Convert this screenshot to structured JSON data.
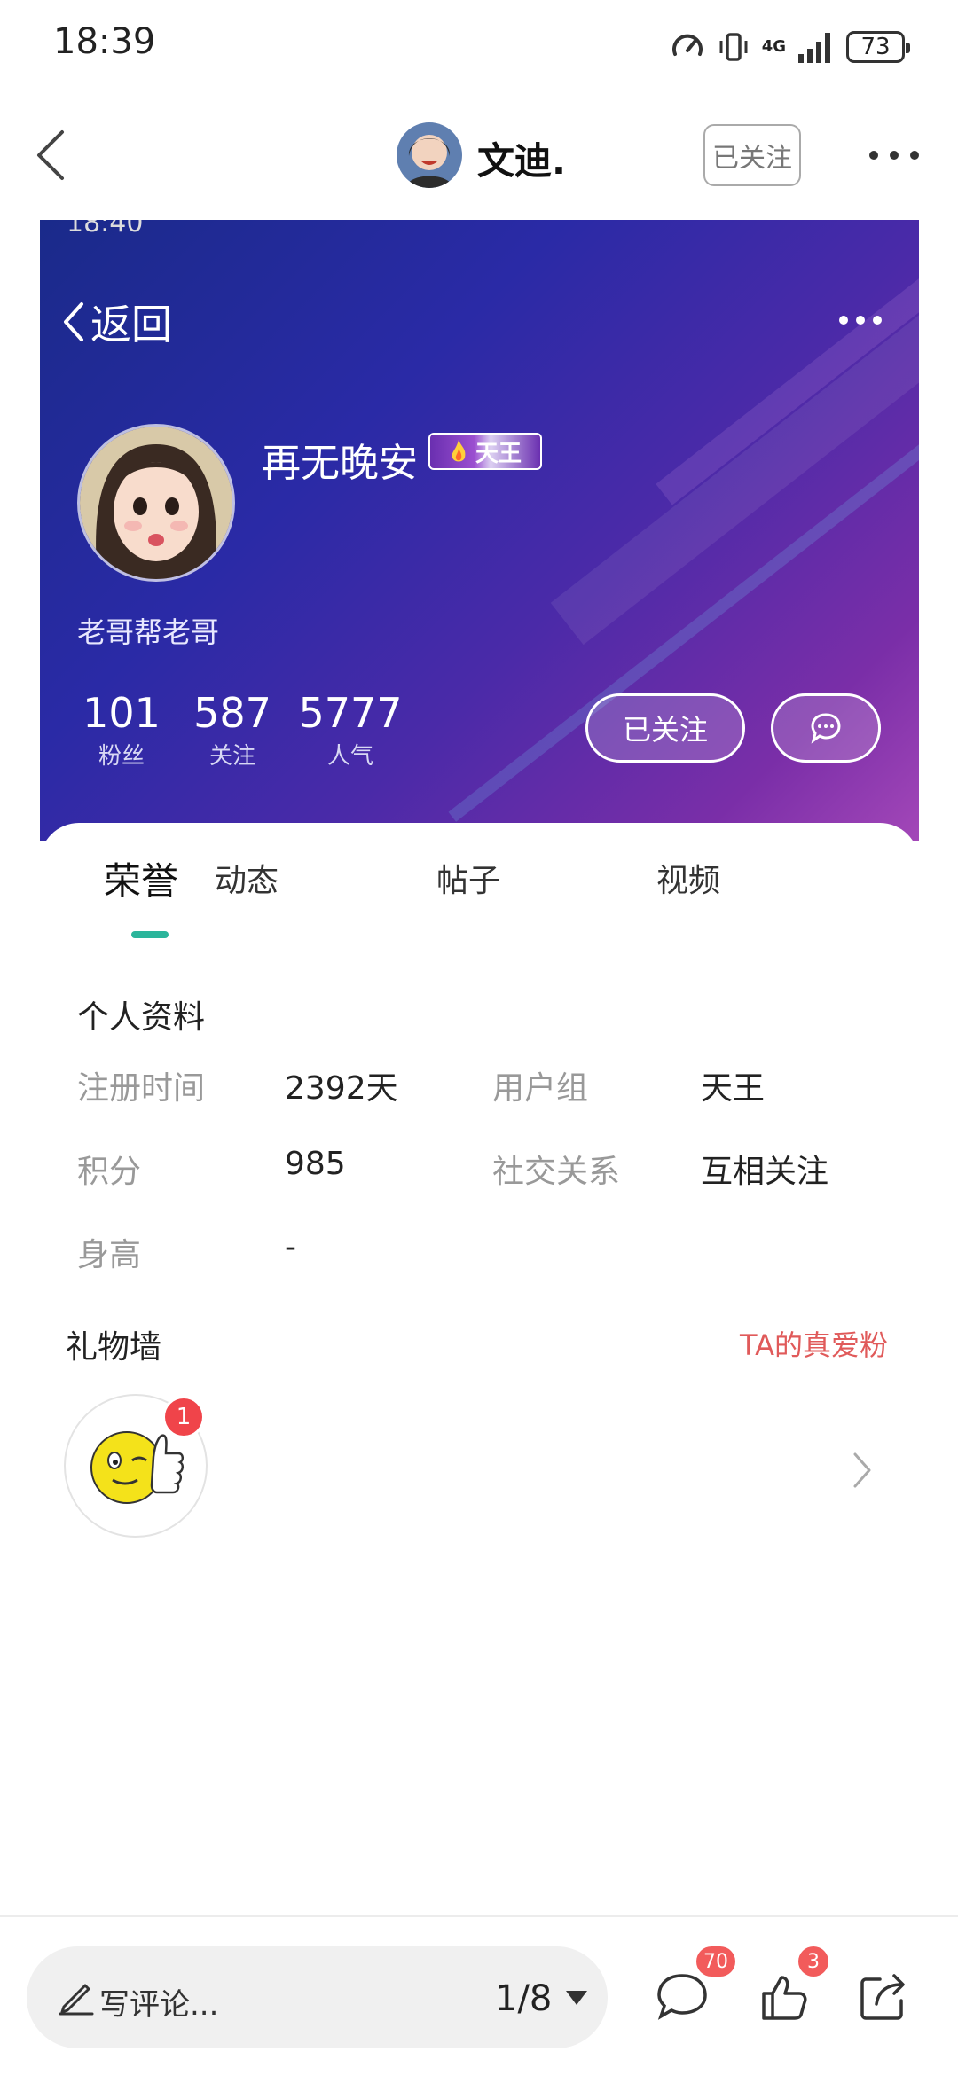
{
  "status_bar": {
    "time": "18:39",
    "network": "4G",
    "battery": "73"
  },
  "nav": {
    "username": "文迪.",
    "follow_label": "已关注"
  },
  "screenshot": {
    "inner_status_time": "18:40",
    "back_label": "返回",
    "profile": {
      "name": "再无晚安",
      "rank_badge": "天王",
      "subtitle": "老哥帮老哥",
      "stats": [
        {
          "value": "101",
          "label": "粉丝"
        },
        {
          "value": "587",
          "label": "关注"
        },
        {
          "value": "5777",
          "label": "人气"
        }
      ],
      "follow_button": "已关注"
    },
    "tabs": [
      {
        "label": "荣誉"
      },
      {
        "label": "动态"
      },
      {
        "label": "帖子"
      },
      {
        "label": "视频"
      }
    ],
    "active_tab": "荣誉",
    "accent_color": "#2bb59b",
    "personal_info": {
      "title": "个人资料",
      "fields": [
        {
          "label": "注册时间",
          "value": "2392天"
        },
        {
          "label": "用户组",
          "value": "天王"
        },
        {
          "label": "积分",
          "value": "985"
        },
        {
          "label": "社交关系",
          "value": "互相关注"
        },
        {
          "label": "身高",
          "value": "-"
        }
      ]
    },
    "gift_wall": {
      "title": "礼物墙",
      "fans_link": "TA的真爱粉",
      "gift_count": "1"
    }
  },
  "bottom_bar": {
    "comment_placeholder": "写评论...",
    "page_indicator": "1/8",
    "comment_count": "70",
    "like_count": "3"
  }
}
